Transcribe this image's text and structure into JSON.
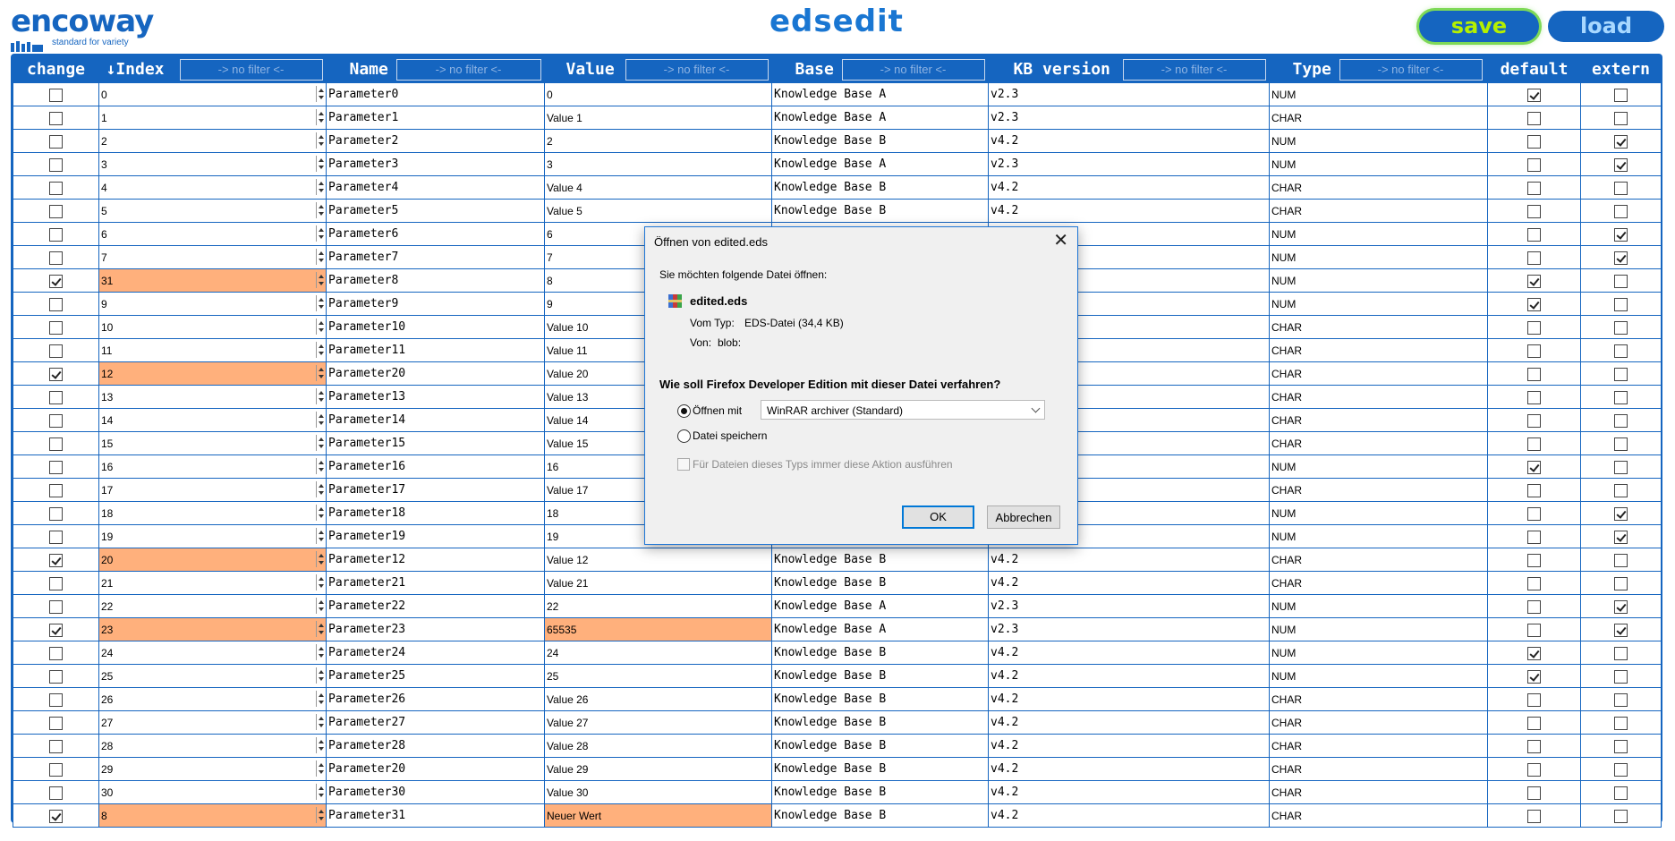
{
  "brand": {
    "name": "encoway",
    "tagline": "standard for variety"
  },
  "app_title": "edsedit",
  "actions": {
    "save_label": "save",
    "load_label": "load"
  },
  "filter_placeholder": "-> no filter <-",
  "columns": [
    {
      "key": "change",
      "label": "change",
      "filter": false
    },
    {
      "key": "index",
      "label": "↓Index",
      "filter": true
    },
    {
      "key": "name",
      "label": "Name",
      "filter": true
    },
    {
      "key": "value",
      "label": "Value",
      "filter": true
    },
    {
      "key": "base",
      "label": "Base",
      "filter": true
    },
    {
      "key": "kb",
      "label": "KB version",
      "filter": true
    },
    {
      "key": "type",
      "label": "Type",
      "filter": true
    },
    {
      "key": "default",
      "label": "default",
      "filter": false
    },
    {
      "key": "extern",
      "label": "extern",
      "filter": false
    }
  ],
  "rows": [
    {
      "change": false,
      "index": "0",
      "name": "Parameter0",
      "value": "0",
      "base": "Knowledge Base A",
      "kb": "v2.3",
      "type": "NUM",
      "default": true,
      "extern": false
    },
    {
      "change": false,
      "index": "1",
      "name": "Parameter1",
      "value": "Value 1",
      "base": "Knowledge Base A",
      "kb": "v2.3",
      "type": "CHAR",
      "default": false,
      "extern": false
    },
    {
      "change": false,
      "index": "2",
      "name": "Parameter2",
      "value": "2",
      "base": "Knowledge Base B",
      "kb": "v4.2",
      "type": "NUM",
      "default": false,
      "extern": true
    },
    {
      "change": false,
      "index": "3",
      "name": "Parameter3",
      "value": "3",
      "base": "Knowledge Base A",
      "kb": "v2.3",
      "type": "NUM",
      "default": false,
      "extern": true
    },
    {
      "change": false,
      "index": "4",
      "name": "Parameter4",
      "value": "Value 4",
      "base": "Knowledge Base B",
      "kb": "v4.2",
      "type": "CHAR",
      "default": false,
      "extern": false
    },
    {
      "change": false,
      "index": "5",
      "name": "Parameter5",
      "value": "Value 5",
      "base": "Knowledge Base B",
      "kb": "v4.2",
      "type": "CHAR",
      "default": false,
      "extern": false
    },
    {
      "change": false,
      "index": "6",
      "name": "Parameter6",
      "value": "6",
      "base": "",
      "kb": "",
      "type": "NUM",
      "default": false,
      "extern": true
    },
    {
      "change": false,
      "index": "7",
      "name": "Parameter7",
      "value": "7",
      "base": "",
      "kb": "",
      "type": "NUM",
      "default": false,
      "extern": true
    },
    {
      "change": true,
      "index": "31",
      "name": "Parameter8",
      "value": "8",
      "base": "",
      "kb": "",
      "type": "NUM",
      "default": true,
      "extern": false,
      "hl_index": true
    },
    {
      "change": false,
      "index": "9",
      "name": "Parameter9",
      "value": "9",
      "base": "",
      "kb": "",
      "type": "NUM",
      "default": true,
      "extern": false
    },
    {
      "change": false,
      "index": "10",
      "name": "Parameter10",
      "value": "Value 10",
      "base": "",
      "kb": "",
      "type": "CHAR",
      "default": false,
      "extern": false
    },
    {
      "change": false,
      "index": "11",
      "name": "Parameter11",
      "value": "Value 11",
      "base": "",
      "kb": "",
      "type": "CHAR",
      "default": false,
      "extern": false
    },
    {
      "change": true,
      "index": "12",
      "name": "Parameter20",
      "value": "Value 20",
      "base": "",
      "kb": "",
      "type": "CHAR",
      "default": false,
      "extern": false,
      "hl_index": true
    },
    {
      "change": false,
      "index": "13",
      "name": "Parameter13",
      "value": "Value 13",
      "base": "",
      "kb": "",
      "type": "CHAR",
      "default": false,
      "extern": false
    },
    {
      "change": false,
      "index": "14",
      "name": "Parameter14",
      "value": "Value 14",
      "base": "",
      "kb": "",
      "type": "CHAR",
      "default": false,
      "extern": false
    },
    {
      "change": false,
      "index": "15",
      "name": "Parameter15",
      "value": "Value 15",
      "base": "",
      "kb": "",
      "type": "CHAR",
      "default": false,
      "extern": false
    },
    {
      "change": false,
      "index": "16",
      "name": "Parameter16",
      "value": "16",
      "base": "",
      "kb": "",
      "type": "NUM",
      "default": true,
      "extern": false
    },
    {
      "change": false,
      "index": "17",
      "name": "Parameter17",
      "value": "Value 17",
      "base": "",
      "kb": "",
      "type": "CHAR",
      "default": false,
      "extern": false
    },
    {
      "change": false,
      "index": "18",
      "name": "Parameter18",
      "value": "18",
      "base": "",
      "kb": "",
      "type": "NUM",
      "default": false,
      "extern": true
    },
    {
      "change": false,
      "index": "19",
      "name": "Parameter19",
      "value": "19",
      "base": "",
      "kb": "",
      "type": "NUM",
      "default": false,
      "extern": true
    },
    {
      "change": true,
      "index": "20",
      "name": "Parameter12",
      "value": "Value 12",
      "base": "Knowledge Base B",
      "kb": "v4.2",
      "type": "CHAR",
      "default": false,
      "extern": false,
      "hl_index": true
    },
    {
      "change": false,
      "index": "21",
      "name": "Parameter21",
      "value": "Value 21",
      "base": "Knowledge Base B",
      "kb": "v4.2",
      "type": "CHAR",
      "default": false,
      "extern": false
    },
    {
      "change": false,
      "index": "22",
      "name": "Parameter22",
      "value": "22",
      "base": "Knowledge Base A",
      "kb": "v2.3",
      "type": "NUM",
      "default": false,
      "extern": true
    },
    {
      "change": true,
      "index": "23",
      "name": "Parameter23",
      "value": "65535",
      "base": "Knowledge Base A",
      "kb": "v2.3",
      "type": "NUM",
      "default": false,
      "extern": true,
      "hl_index": true,
      "hl_value": true
    },
    {
      "change": false,
      "index": "24",
      "name": "Parameter24",
      "value": "24",
      "base": "Knowledge Base B",
      "kb": "v4.2",
      "type": "NUM",
      "default": true,
      "extern": false
    },
    {
      "change": false,
      "index": "25",
      "name": "Parameter25",
      "value": "25",
      "base": "Knowledge Base B",
      "kb": "v4.2",
      "type": "NUM",
      "default": true,
      "extern": false
    },
    {
      "change": false,
      "index": "26",
      "name": "Parameter26",
      "value": "Value 26",
      "base": "Knowledge Base B",
      "kb": "v4.2",
      "type": "CHAR",
      "default": false,
      "extern": false
    },
    {
      "change": false,
      "index": "27",
      "name": "Parameter27",
      "value": "Value 27",
      "base": "Knowledge Base B",
      "kb": "v4.2",
      "type": "CHAR",
      "default": false,
      "extern": false
    },
    {
      "change": false,
      "index": "28",
      "name": "Parameter28",
      "value": "Value 28",
      "base": "Knowledge Base B",
      "kb": "v4.2",
      "type": "CHAR",
      "default": false,
      "extern": false
    },
    {
      "change": false,
      "index": "29",
      "name": "Parameter20",
      "value": "Value 29",
      "base": "Knowledge Base B",
      "kb": "v4.2",
      "type": "CHAR",
      "default": false,
      "extern": false
    },
    {
      "change": false,
      "index": "30",
      "name": "Parameter30",
      "value": "Value 30",
      "base": "Knowledge Base B",
      "kb": "v4.2",
      "type": "CHAR",
      "default": false,
      "extern": false
    },
    {
      "change": true,
      "index": "8",
      "name": "Parameter31",
      "value": "Neuer Wert",
      "base": "Knowledge Base B",
      "kb": "v4.2",
      "type": "CHAR",
      "default": false,
      "extern": false,
      "hl_index": true,
      "hl_value": true
    }
  ],
  "dialog": {
    "title": "Öffnen von edited.eds",
    "intro": "Sie möchten folgende Datei öffnen:",
    "file_name": "edited.eds",
    "type_label": "Vom Typ:",
    "type_value": "EDS-Datei (34,4 KB)",
    "from_label": "Von:",
    "from_value": "blob:",
    "question": "Wie soll Firefox Developer Edition mit dieser Datei verfahren?",
    "open_with_label": "Öffnen mit",
    "open_with_app": "WinRAR archiver (Standard)",
    "save_file_label": "Datei speichern",
    "always_label": "Für Dateien dieses Typs immer diese Aktion ausführen",
    "ok_label": "OK",
    "cancel_label": "Abbrechen",
    "selected_option": "open_with"
  },
  "colors": {
    "header_blue": "#1565c0",
    "save_text": "#b5f000",
    "save_glow": "#7ed957",
    "highlight": "#ffb07c"
  }
}
